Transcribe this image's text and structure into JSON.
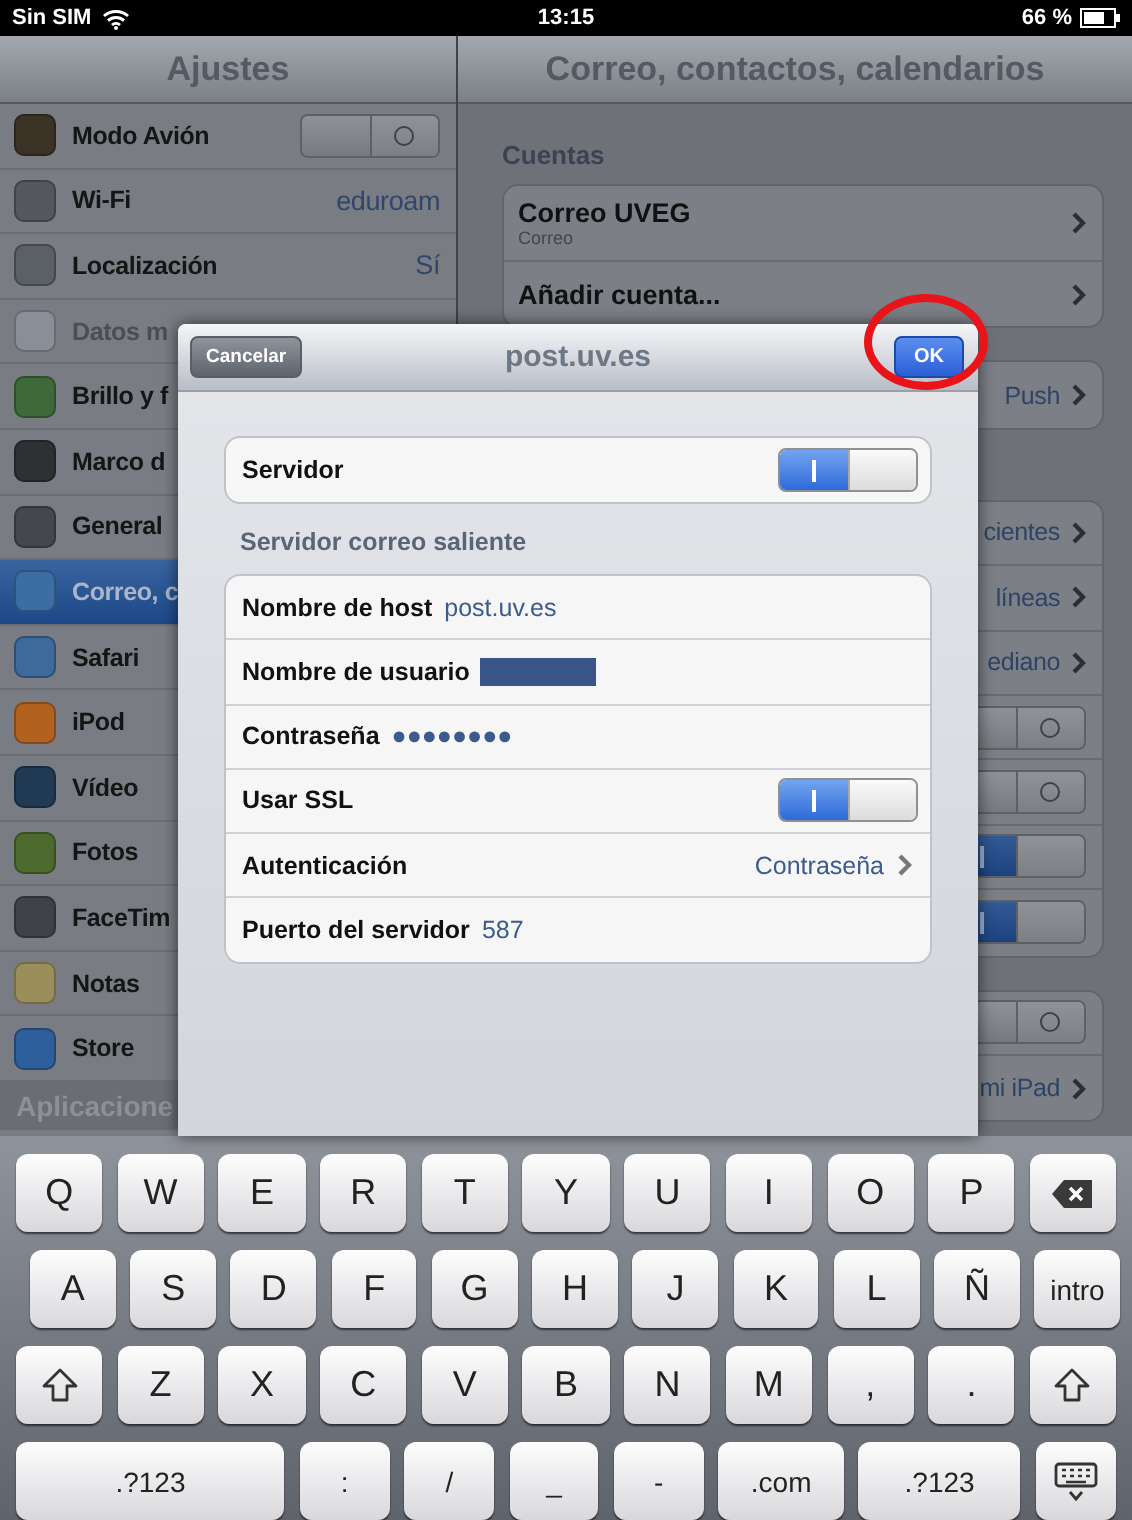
{
  "status_bar": {
    "carrier": "Sin SIM",
    "time": "13:15",
    "battery": "66 %"
  },
  "sidebar": {
    "title": "Ajustes",
    "items": [
      {
        "label": "Modo Avión",
        "kind": "toggle",
        "on": false,
        "disabled": false,
        "selected": false,
        "color": "#3a3326"
      },
      {
        "label": "Wi-Fi",
        "kind": "value",
        "value": "eduroam",
        "disabled": false,
        "selected": false,
        "color": "#55585e"
      },
      {
        "label": "Localización",
        "kind": "value",
        "value": "Sí",
        "disabled": false,
        "selected": false,
        "color": "#5b5f66"
      },
      {
        "label": "Datos m",
        "kind": "plain",
        "disabled": true,
        "selected": false,
        "color": "#8a8e96"
      },
      {
        "label": "Brillo y f",
        "kind": "plain",
        "disabled": false,
        "selected": false,
        "color": "#3e6a3a"
      },
      {
        "label": "Marco d",
        "kind": "plain",
        "disabled": false,
        "selected": false,
        "color": "#2e3034"
      },
      {
        "label": "General",
        "kind": "plain",
        "disabled": false,
        "selected": false,
        "color": "#44474c"
      },
      {
        "label": "Correo, c",
        "kind": "plain",
        "disabled": false,
        "selected": true,
        "color": "#3c6ea4"
      },
      {
        "label": "Safari",
        "kind": "plain",
        "disabled": false,
        "selected": false,
        "color": "#3d6a9a"
      },
      {
        "label": "iPod",
        "kind": "plain",
        "disabled": false,
        "selected": false,
        "color": "#b0621e"
      },
      {
        "label": "Vídeo",
        "kind": "plain",
        "disabled": false,
        "selected": false,
        "color": "#1f3a52"
      },
      {
        "label": "Fotos",
        "kind": "plain",
        "disabled": false,
        "selected": false,
        "color": "#4d6a2e"
      },
      {
        "label": "FaceTim",
        "kind": "plain",
        "disabled": false,
        "selected": false,
        "color": "#3f4248"
      },
      {
        "label": "Notas",
        "kind": "plain",
        "disabled": false,
        "selected": false,
        "color": "#9a8f5a"
      },
      {
        "label": "Store",
        "kind": "plain",
        "disabled": false,
        "selected": false,
        "color": "#2f5f9a"
      }
    ],
    "section": "Aplicacione"
  },
  "detail": {
    "title": "Correo, contactos, calendarios",
    "accounts_header": "Cuentas",
    "groups": [
      [
        {
          "kind": "account",
          "title": "Correo UVEG",
          "subtitle": "Correo"
        },
        {
          "kind": "link",
          "title": "Añadir cuenta..."
        }
      ],
      [
        {
          "kind": "value",
          "value": "Push"
        }
      ],
      [
        {
          "kind": "value",
          "value": "cientes"
        },
        {
          "kind": "value",
          "value": "líneas"
        },
        {
          "kind": "value",
          "value": "ediano"
        },
        {
          "kind": "toggle",
          "on": false
        },
        {
          "kind": "toggle",
          "on": false
        },
        {
          "kind": "toggle",
          "on": true
        },
        {
          "kind": "toggle",
          "on": true
        }
      ],
      [
        {
          "kind": "toggle",
          "on": false
        },
        {
          "kind": "value",
          "value": "mi iPad"
        }
      ]
    ]
  },
  "dialog": {
    "title": "post.uv.es",
    "cancel": "Cancelar",
    "ok": "OK",
    "ok_highlighted": true,
    "server": {
      "label": "Servidor",
      "on": true
    },
    "section": "Servidor correo saliente",
    "rows": [
      {
        "kind": "text",
        "label": "Nombre de host",
        "value": "post.uv.es"
      },
      {
        "kind": "redacted",
        "label": "Nombre de usuario"
      },
      {
        "kind": "text",
        "label": "Contraseña",
        "value": "●●●●●●●●"
      },
      {
        "kind": "toggle",
        "label": "Usar SSL",
        "on": true
      },
      {
        "kind": "choice",
        "label": "Autenticación",
        "value": "Contraseña"
      },
      {
        "kind": "text",
        "label": "Puerto del servidor",
        "value": "587"
      }
    ]
  },
  "keyboard": {
    "rows": [
      {
        "keys": [
          {
            "kind": "char",
            "label": "Q"
          },
          {
            "kind": "char",
            "label": "W"
          },
          {
            "kind": "char",
            "label": "E"
          },
          {
            "kind": "char",
            "label": "R"
          },
          {
            "kind": "char",
            "label": "T"
          },
          {
            "kind": "char",
            "label": "Y"
          },
          {
            "kind": "char",
            "label": "U"
          },
          {
            "kind": "char",
            "label": "I"
          },
          {
            "kind": "char",
            "label": "O"
          },
          {
            "kind": "char",
            "label": "P"
          },
          {
            "kind": "backspace"
          }
        ]
      },
      {
        "keys": [
          {
            "kind": "char",
            "label": "A"
          },
          {
            "kind": "char",
            "label": "S"
          },
          {
            "kind": "char",
            "label": "D"
          },
          {
            "kind": "char",
            "label": "F"
          },
          {
            "kind": "char",
            "label": "G"
          },
          {
            "kind": "char",
            "label": "H"
          },
          {
            "kind": "char",
            "label": "J"
          },
          {
            "kind": "char",
            "label": "K"
          },
          {
            "kind": "char",
            "label": "L"
          },
          {
            "kind": "char",
            "label": "Ñ"
          },
          {
            "kind": "enter",
            "label": "intro"
          }
        ]
      },
      {
        "keys": [
          {
            "kind": "shift"
          },
          {
            "kind": "char",
            "label": "Z"
          },
          {
            "kind": "char",
            "label": "X"
          },
          {
            "kind": "char",
            "label": "C"
          },
          {
            "kind": "char",
            "label": "V"
          },
          {
            "kind": "char",
            "label": "B"
          },
          {
            "kind": "char",
            "label": "N"
          },
          {
            "kind": "char",
            "label": "M"
          },
          {
            "kind": "char",
            "label": ","
          },
          {
            "kind": "char",
            "label": "."
          },
          {
            "kind": "shift"
          }
        ]
      },
      {
        "keys": [
          {
            "kind": "mode",
            "label": ".?123"
          },
          {
            "kind": "char",
            "label": ":"
          },
          {
            "kind": "char",
            "label": "/"
          },
          {
            "kind": "char",
            "label": "_"
          },
          {
            "kind": "char",
            "label": "-"
          },
          {
            "kind": "wide",
            "label": ".com"
          },
          {
            "kind": "mode2",
            "label": ".?123"
          },
          {
            "kind": "hide"
          }
        ]
      }
    ]
  }
}
